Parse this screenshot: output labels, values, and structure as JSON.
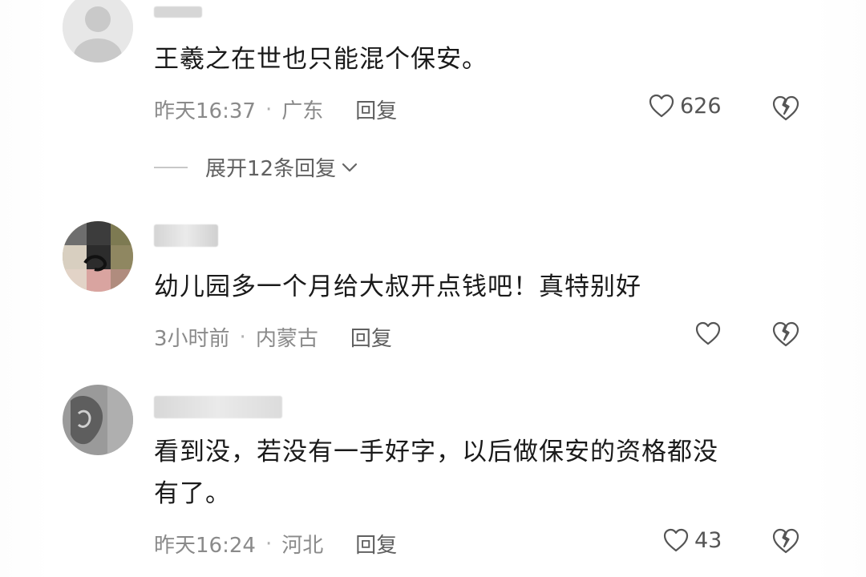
{
  "comments": [
    {
      "text_lines": [
        "王羲之在世也只能混个保安。"
      ],
      "time": "昨天16:37",
      "location": "广东",
      "reply_label": "回复",
      "likes": "626",
      "expand_label": "展开12条回复"
    },
    {
      "text_lines": [
        "幼儿园多一个月给大叔开点钱吧！真特别好"
      ],
      "time": "3小时前",
      "location": "内蒙古",
      "reply_label": "回复",
      "likes": ""
    },
    {
      "text_lines": [
        "看到没，若没有一手好字，以后做保安的资格都没",
        "有了。"
      ],
      "time": "昨天16:24",
      "location": "河北",
      "reply_label": "回复",
      "likes": "43"
    }
  ],
  "separator": "·",
  "icons": {
    "like": "heart-outline-icon",
    "dislike": "broken-heart-icon",
    "expand": "chevron-down-icon"
  },
  "colors": {
    "text": "#1a1a1a",
    "meta": "#8a8a8a",
    "icon": "#555555"
  }
}
